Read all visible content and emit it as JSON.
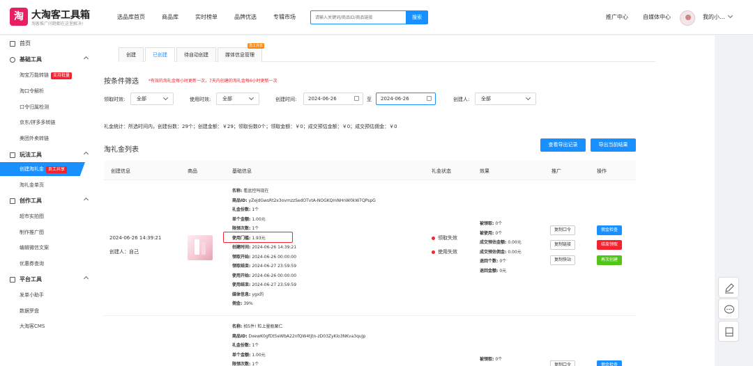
{
  "app": {
    "logo_letter": "淘",
    "title": "大淘客工具箱",
    "subtitle": "淘客推广问题都在这里解决!"
  },
  "topnav": [
    "选品库首页",
    "商品库",
    "实时榜单",
    "品牌优选",
    "专辑市场"
  ],
  "search": {
    "placeholder": "请输入关键词/商品ID/商品链接",
    "button": "搜索"
  },
  "header_right": {
    "promo": "推广中心",
    "media": "自媒体中心",
    "user": "我的小..."
  },
  "sidebar": {
    "home": "首页",
    "group_basic": "基础工具",
    "basic_items": [
      "淘宝万能转链",
      "淘口令解析",
      "口令归属检测",
      "京东/拼多多转链",
      "美团外卖转链"
    ],
    "basic_badge": "支持批量",
    "group_play": "玩法工具",
    "active_item": "创建淘礼金",
    "active_badge": "员工共享",
    "play_items": [
      "淘礼金单页"
    ],
    "group_create": "创作工具",
    "create_items": [
      "超市实拍图",
      "制作推广图",
      "编辑微信文案",
      "优惠券查询"
    ],
    "group_platform": "平台工具",
    "platform_items": [
      "发单小助手",
      "数据罗盘",
      "大淘客CMS"
    ]
  },
  "tabs": [
    {
      "label": "创建",
      "active": false
    },
    {
      "label": "已创建",
      "active": true
    },
    {
      "label": "待自动创建",
      "active": false
    },
    {
      "label": "媒体信息管理",
      "active": false,
      "badge": "员工共享"
    }
  ],
  "filter": {
    "title": "按条件筛选",
    "note": "*有效的淘礼金每小时更新一次，7天内创建的淘礼金每6小时更新一次",
    "claim_label": "领取时效:",
    "claim_value": "全部",
    "use_label": "使用时效:",
    "use_value": "全部",
    "created_label": "创建时间:",
    "date_from": "2024-06-26",
    "to": "至",
    "date_to": "2024-06-26",
    "creator_label": "创建人:",
    "creator_value": "全部"
  },
  "stats": "礼金统计：所选时间内，创建份数：29个；创建金额：￥29；领取份数0个；领取金额：￥0；成交预估金额：￥0；成交预估佣金：￥0",
  "list": {
    "title": "淘礼金列表",
    "btn_records": "查看导出记录",
    "btn_export": "导出当前结果",
    "headers": [
      "创建信息",
      "商品",
      "基础信息",
      "礼金状态",
      "效果",
      "推广",
      "操作"
    ]
  },
  "row1": {
    "created_time": "2024-06-26 14:39:21",
    "creator": "创建人：自己",
    "info": [
      {
        "k": "名称:",
        "v": "看盆控吗现在"
      },
      {
        "k": "商品ID:",
        "v": "yZejdGwsRt2x3ovmzzSedOTvtA-NOGKQmNHnW0kW7QPspG"
      },
      {
        "k": "礼金份数:",
        "v": "1个"
      },
      {
        "k": "单个金额:",
        "v": "1.00元"
      },
      {
        "k": "限领次数:",
        "v": "1个"
      },
      {
        "k": "使用门槛:",
        "v": "1.93元"
      },
      {
        "k": "创建时间:",
        "v": "2024-06-26 14:39:21"
      },
      {
        "k": "领取开始:",
        "v": "2024-06-26 00:00:00"
      },
      {
        "k": "领取结束:",
        "v": "2024-06-27 23:59:59"
      },
      {
        "k": "使用开始:",
        "v": "2024-06-26 00:00:00"
      },
      {
        "k": "使用结束:",
        "v": "2024-06-27 23:59:59"
      },
      {
        "k": "媒体信息:",
        "v": "ygx的"
      },
      {
        "k": "佣金:",
        "v": "39%"
      }
    ],
    "status": [
      "领取失效",
      "使用失效"
    ],
    "effect": [
      {
        "k": "被领取:",
        "v": "0个"
      },
      {
        "k": "被使用:",
        "v": "0个"
      },
      {
        "k": "成交预估金额:",
        "v": "0.00元"
      },
      {
        "k": "成交预估佣金:",
        "v": "0.00元"
      },
      {
        "k": "退回个数:",
        "v": "0个"
      },
      {
        "k": "退回金额:",
        "v": "0元"
      }
    ],
    "promo_buttons": [
      "复制口令",
      "复制链接",
      "复制快站"
    ],
    "actions": [
      {
        "label": "佣金检查",
        "color": "#1890ff"
      },
      {
        "label": "结束领取",
        "color": "#f5222d"
      },
      {
        "label": "再次创建",
        "color": "#52c41a"
      }
    ]
  },
  "row2": {
    "info": [
      {
        "k": "名称:",
        "v": "拍5件! 粒上量瓶栗仁"
      },
      {
        "k": "商品ID:",
        "v": "DxewK0gfDt5eWbA22nfQW4tjtn-zD03ZyKlo3NKva3quJp"
      },
      {
        "k": "礼金份数:",
        "v": "1个"
      },
      {
        "k": "单个金额:",
        "v": "1.00元"
      },
      {
        "k": "限领次数:",
        "v": "1个"
      }
    ],
    "effect_first": {
      "k": "被领取:",
      "v": "0个"
    },
    "promo_first": "复制口令",
    "action_first": "佣金检查"
  }
}
